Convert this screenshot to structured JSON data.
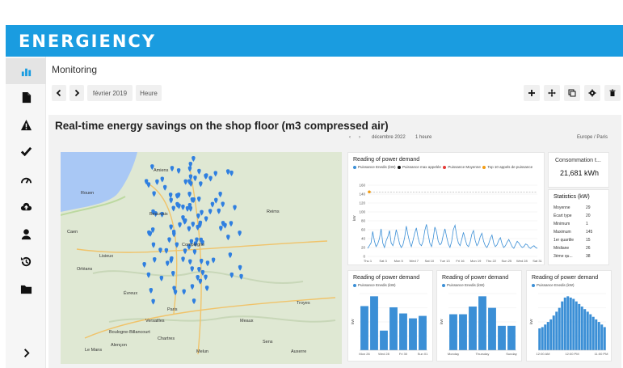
{
  "app": {
    "brand": "ENERGIENCY",
    "page_title": "Monitoring"
  },
  "sidebar": {
    "items": [
      {
        "name": "sidebar-item-dashboards",
        "icon": "bar-chart-icon",
        "active": true
      },
      {
        "name": "sidebar-item-documents",
        "icon": "file-icon",
        "active": false
      },
      {
        "name": "sidebar-item-alerts",
        "icon": "warning-icon",
        "active": false
      },
      {
        "name": "sidebar-item-tasks",
        "icon": "check-icon",
        "active": false
      },
      {
        "name": "sidebar-item-performance",
        "icon": "gauge-icon",
        "active": false
      },
      {
        "name": "sidebar-item-upload",
        "icon": "cloud-upload-icon",
        "active": false
      },
      {
        "name": "sidebar-item-users",
        "icon": "user-icon",
        "active": false
      },
      {
        "name": "sidebar-item-history",
        "icon": "history-icon",
        "active": false
      },
      {
        "name": "sidebar-item-folders",
        "icon": "folder-icon",
        "active": false
      }
    ],
    "expand_icon": "chevron-right-icon"
  },
  "toolbar": {
    "period_label": "février 2019",
    "granularity_label": "Heure",
    "actions": [
      "add-icon",
      "move-icon",
      "copy-icon",
      "settings-icon",
      "delete-icon"
    ]
  },
  "dashboard": {
    "title": "Real-time energy savings on the shop floor (m3 compressed air)",
    "inner_period": "décembre 2022",
    "inner_granularity": "1 heure",
    "timezone": "Europe / Paris"
  },
  "map": {
    "cities": [
      "Paris",
      "Orléans",
      "Amiens",
      "Rouen",
      "Reims",
      "Caen",
      "Compiègne",
      "Chartres",
      "Troyes",
      "Évreux",
      "Alençon",
      "Le Mans",
      "Lisieux",
      "Beauvais",
      "Meaux",
      "Sens",
      "Auxerre",
      "Melun",
      "Versailles",
      "Boulogne-Billancourt"
    ],
    "marker_color": "#2f7fe0",
    "markers": 118
  },
  "main_chart": {
    "title": "Reading of power demand",
    "legend": [
      {
        "label": "Puissance Enedis (kW)",
        "color": "#3b8fd6"
      },
      {
        "label": "Puissance max appelée",
        "color": "#111111"
      },
      {
        "label": "Puissance Moyenne",
        "color": "#e53935"
      },
      {
        "label": "Top 10 appels de puissance",
        "color": "#f39c12"
      }
    ],
    "y_ticks": [
      "160",
      "140",
      "120",
      "100",
      "80",
      "60",
      "40",
      "20",
      "0"
    ],
    "x_ticks": [
      "Thu 1",
      "Sat 3",
      "Mon 5",
      "Wed 7",
      "Sat 10",
      "Tue 13",
      "Fri 16",
      "Mon 19",
      "Thu 22",
      "Sun 25",
      "Wed 28",
      "Sat 31"
    ],
    "ylabel": "kW"
  },
  "consumption": {
    "title": "Consommation t...",
    "value": "21,681 kWh"
  },
  "statistics": {
    "title": "Statistics (kW)",
    "rows": [
      {
        "label": "Moyenne",
        "value": "29"
      },
      {
        "label": "Écart type",
        "value": "20"
      },
      {
        "label": "Minimum",
        "value": "1"
      },
      {
        "label": "Maximum",
        "value": "145"
      },
      {
        "label": "1er quartile",
        "value": "15"
      },
      {
        "label": "Médiane",
        "value": "26"
      },
      {
        "label": "3ème qu...",
        "value": "38"
      }
    ]
  },
  "chart_data": [
    {
      "type": "line",
      "title": "Reading of power demand",
      "ylabel": "kW",
      "ylim": [
        0,
        160
      ],
      "series": [
        {
          "name": "Puissance Enedis (kW)",
          "values": [
            18,
            24,
            30,
            56,
            35,
            22,
            28,
            40,
            62,
            30,
            20,
            35,
            44,
            58,
            30,
            24,
            38,
            60,
            46,
            28,
            20,
            26,
            42,
            68,
            48,
            32,
            22,
            36,
            52,
            64,
            42,
            28,
            24,
            34,
            58,
            72,
            50,
            30,
            22,
            40,
            66,
            55,
            34,
            26,
            30,
            48,
            62,
            44,
            28,
            20,
            34,
            60,
            70,
            46,
            30,
            24,
            38,
            54,
            40,
            26,
            22,
            32,
            50,
            58,
            36,
            24,
            30,
            44,
            52,
            34,
            24,
            20,
            28,
            40,
            48,
            30,
            22,
            26,
            36,
            42,
            28,
            20,
            24,
            32,
            38,
            30,
            22,
            18,
            26,
            34,
            30,
            24,
            20,
            22,
            28,
            26,
            20,
            18,
            22,
            24,
            20,
            18
          ]
        },
        {
          "name": "Puissance max appelée",
          "values": [
            145
          ]
        },
        {
          "name": "Top 10 appels de puissance",
          "values": [
            145
          ]
        }
      ]
    },
    {
      "type": "bar",
      "title": "Reading of power demand",
      "categories": [
        "Mon 26",
        "Tue 27",
        "Wed 28",
        "Thu 29",
        "Fri 30",
        "Sat 31",
        "Sun 01"
      ],
      "series": [
        {
          "name": "Puissance Enedis (kW)",
          "values": [
            36,
            44,
            16,
            35,
            30,
            26,
            28
          ]
        }
      ],
      "x_ticks": [
        "Mon 26",
        "Wed 28",
        "Fri 30",
        "Sun 01"
      ],
      "ylabel": "kW"
    },
    {
      "type": "bar",
      "title": "Reading of power demand",
      "categories": [
        "Monday",
        "Tuesday",
        "Wednesday",
        "Thursday",
        "Friday",
        "Saturday",
        "Sunday"
      ],
      "series": [
        {
          "name": "Puissance Enedis (kW)",
          "values": [
            28,
            28,
            34,
            42,
            33,
            19,
            19
          ]
        }
      ],
      "x_ticks": [
        "Monday",
        "Thursday",
        "Sunday"
      ],
      "ylabel": "kW"
    },
    {
      "type": "bar",
      "title": "Reading of power demand",
      "categories": [
        "00:00",
        "01:00",
        "02:00",
        "03:00",
        "04:00",
        "05:00",
        "06:00",
        "07:00",
        "08:00",
        "09:00",
        "10:00",
        "11:00",
        "12:00",
        "13:00",
        "14:00",
        "15:00",
        "16:00",
        "17:00",
        "18:00",
        "19:00",
        "20:00",
        "21:00",
        "22:00",
        "23:00"
      ],
      "series": [
        {
          "name": "Puissance Enedis (kW)",
          "values": [
            17,
            18,
            20,
            22,
            24,
            27,
            30,
            33,
            38,
            41,
            42,
            41,
            40,
            38,
            36,
            34,
            32,
            30,
            28,
            26,
            24,
            22,
            20,
            18
          ]
        }
      ],
      "x_ticks": [
        "12:00 AM",
        "12:00 PM",
        "11:00 PM"
      ],
      "ylabel": "kW"
    }
  ]
}
